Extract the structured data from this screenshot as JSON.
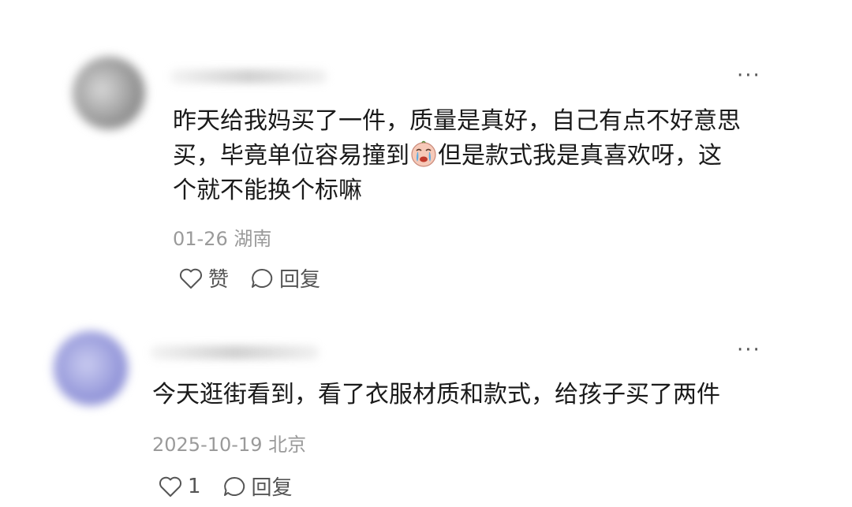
{
  "comments": [
    {
      "text_parts": [
        "昨天给我妈买了一件，质量是真好，自己有点不好意思",
        "买，毕竟单位容易撞到",
        "但是款式我是真喜欢呀，这",
        "个就不能换个标嘛"
      ],
      "emoji": "crying-face-emoji",
      "date": "01-26",
      "location": "湖南",
      "like_label": "赞",
      "reply_label": "回复",
      "more": "···",
      "avatar_color": "#9a9a9a"
    },
    {
      "text": "今天逛街看到，看了衣服材质和款式，给孩子买了两件",
      "date": "2025-10-19",
      "location": "北京",
      "like_label": "1",
      "reply_label": "回复",
      "more": "···",
      "avatar_color": "#8c8fd6"
    }
  ]
}
